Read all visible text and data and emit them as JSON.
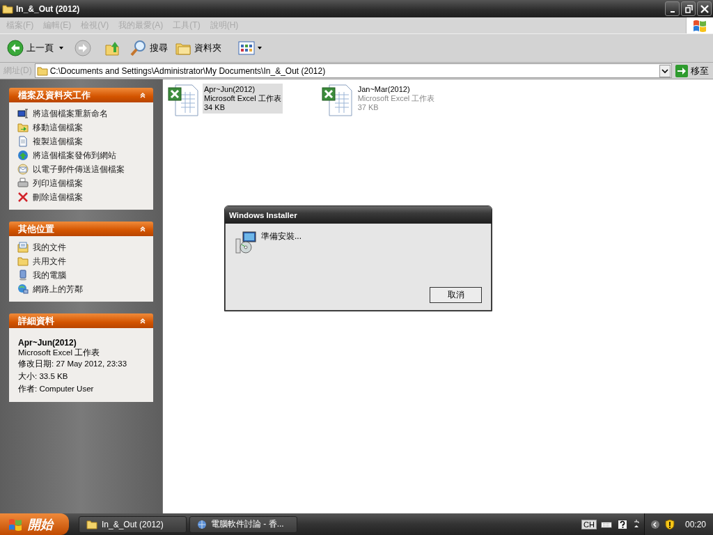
{
  "window": {
    "title": "In_&_Out (2012)"
  },
  "menu": [
    {
      "label": "檔案(F)",
      "disabled": true
    },
    {
      "label": "編輯(E)",
      "disabled": true
    },
    {
      "label": "檢視(V)",
      "disabled": true
    },
    {
      "label": "我的最愛(A)",
      "disabled": true
    },
    {
      "label": "工具(T)",
      "disabled": true
    },
    {
      "label": "說明(H)",
      "disabled": true
    }
  ],
  "toolbar": {
    "back": "上一頁",
    "search": "搜尋",
    "folders": "資料夾"
  },
  "address": {
    "label": "網址(D)",
    "value": "C:\\Documents and Settings\\Administrator\\My Documents\\In_&_Out (2012)",
    "go": "移至"
  },
  "sidebar": [
    {
      "kind": "links",
      "title": "檔案及資料夾工作",
      "expanded": true,
      "items": [
        "將這個檔案重新命名",
        "移動這個檔案",
        "複製這個檔案",
        "將這個檔案發佈到網站",
        "以電子郵件傳送這個檔案",
        "列印這個檔案",
        "刪除這個檔案"
      ]
    },
    {
      "kind": "places",
      "title": "其他位置",
      "expanded": true,
      "items": [
        "我的文件",
        "共用文件",
        "我的電腦",
        "網路上的芳鄰"
      ]
    },
    {
      "kind": "details",
      "title": "詳細資料",
      "expanded": true,
      "name": "Apr~Jun(2012)",
      "items": [
        "Microsoft Excel 工作表",
        "修改日期: 27 May 2012, 23:33",
        "大小: 33.5 KB",
        "作者: Computer User"
      ]
    }
  ],
  "files": [
    {
      "name": "Apr~Jun(2012)",
      "type": "Microsoft Excel 工作表",
      "size": "34 KB",
      "selected": true
    },
    {
      "name": "Jan~Mar(2012)",
      "type": "Microsoft Excel 工作表",
      "size": "37 KB",
      "selected": false
    }
  ],
  "dialog": {
    "title": "Windows Installer",
    "message": "準備安裝...",
    "button": "取消"
  },
  "taskbar": {
    "start": "開始",
    "tasks": [
      {
        "label": "In_&_Out (2012)",
        "selected": false
      },
      {
        "label": "電腦軟件討論 - 香...",
        "selected": false
      }
    ],
    "language": "CH",
    "clock": "00:20"
  }
}
